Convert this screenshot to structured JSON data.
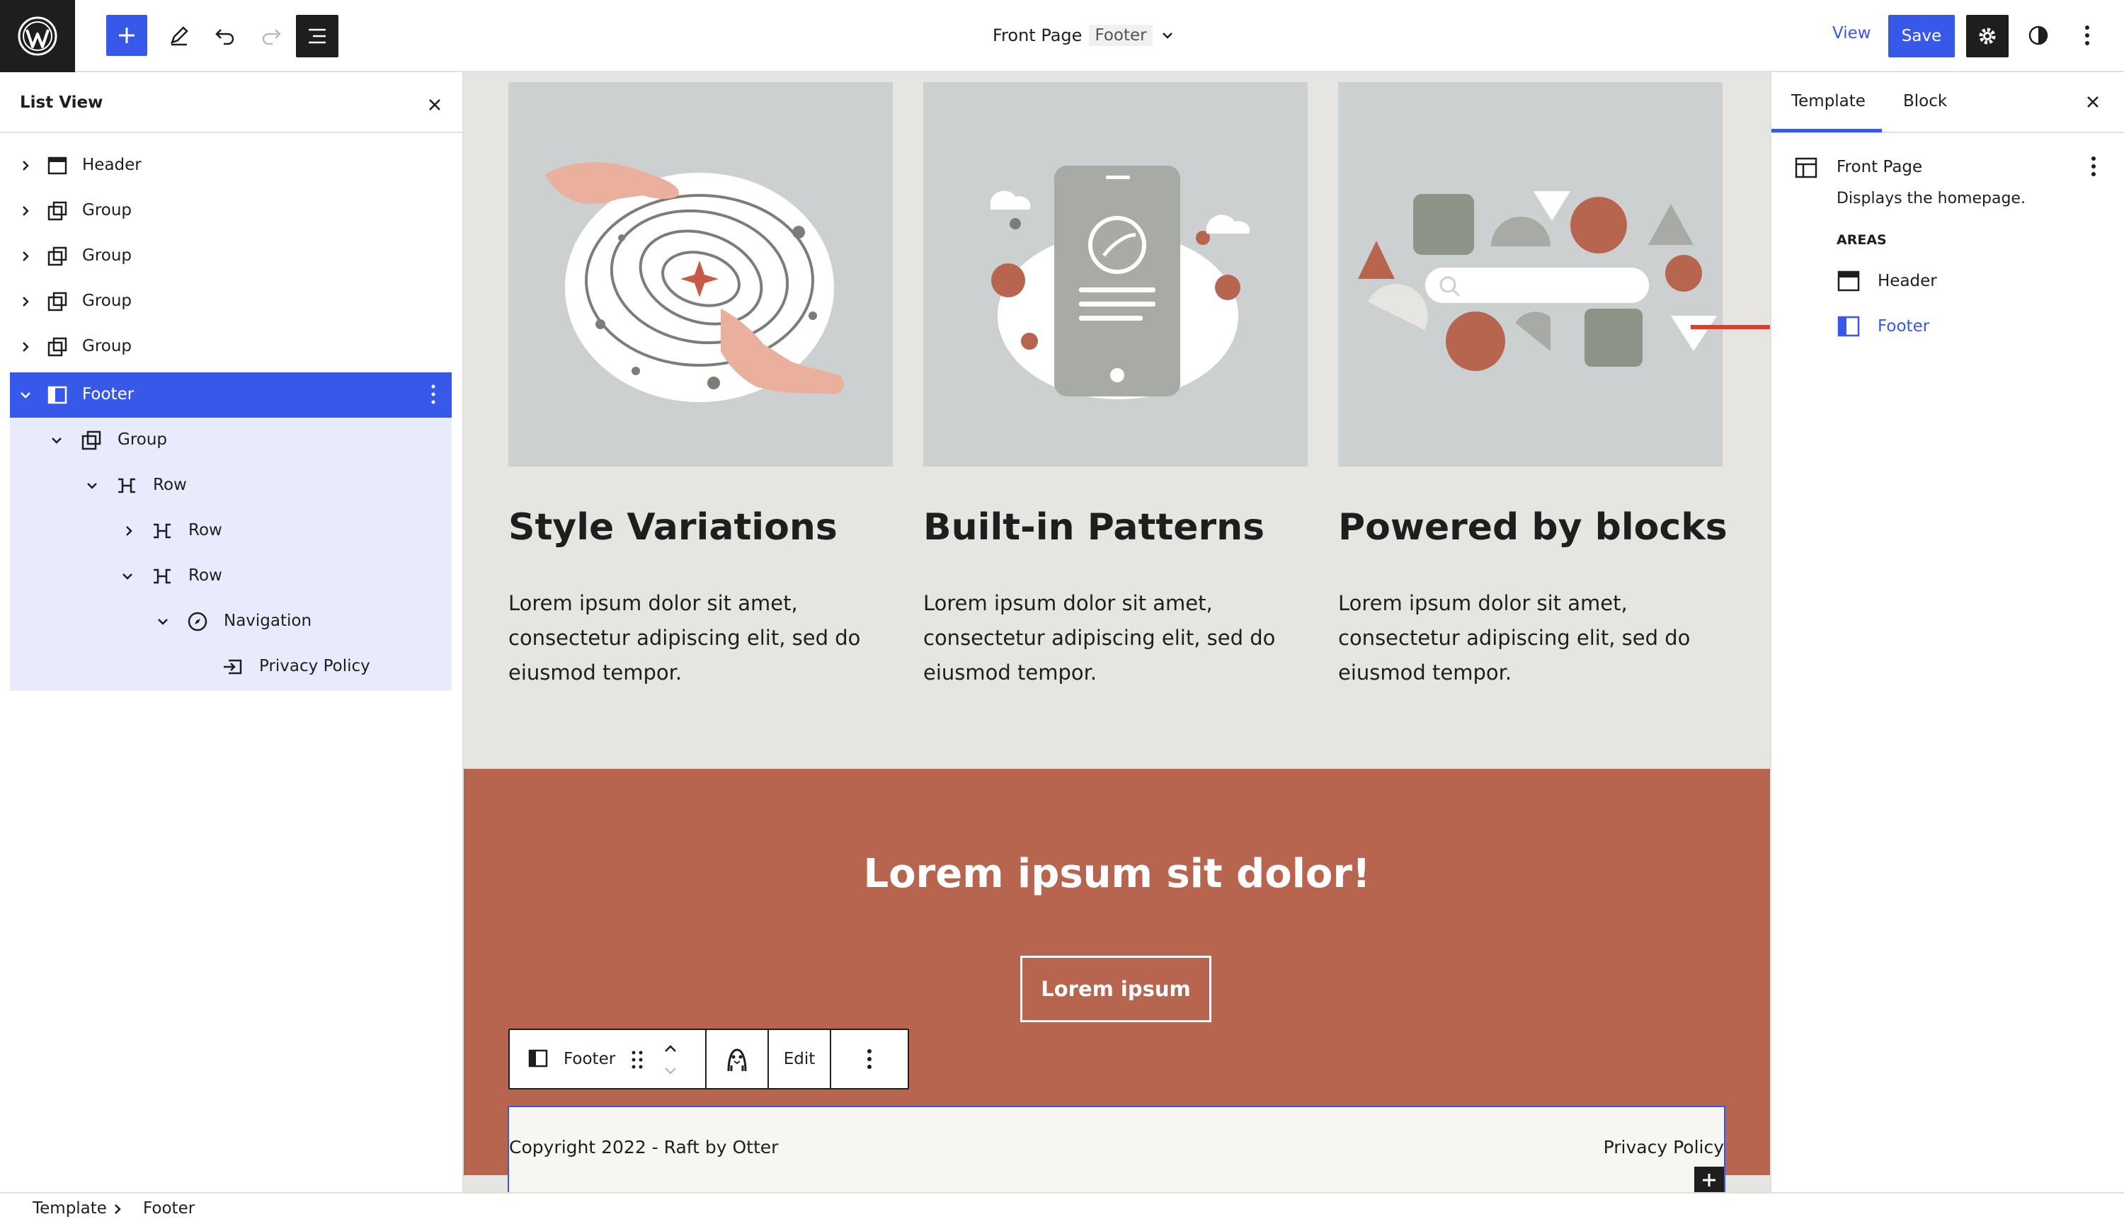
{
  "topbar": {
    "document_title": "Front Page",
    "document_tag": "Footer",
    "view_label": "View",
    "save_label": "Save"
  },
  "list_view": {
    "title": "List View",
    "items": [
      {
        "label": "Header"
      },
      {
        "label": "Group"
      },
      {
        "label": "Group"
      },
      {
        "label": "Group"
      },
      {
        "label": "Group"
      },
      {
        "label": "Footer"
      },
      {
        "label": "Group"
      },
      {
        "label": "Row"
      },
      {
        "label": "Row"
      },
      {
        "label": "Row"
      },
      {
        "label": "Navigation"
      },
      {
        "label": "Privacy Policy"
      }
    ]
  },
  "canvas": {
    "cards": [
      {
        "title": "Style Variations",
        "text": "Lorem ipsum dolor sit amet, consectetur adipiscing elit, sed do eiusmod tempor."
      },
      {
        "title": "Built-in Patterns",
        "text": "Lorem ipsum dolor sit amet, consectetur adipiscing elit, sed do eiusmod tempor."
      },
      {
        "title": "Powered by blocks",
        "text": "Lorem ipsum dolor sit amet, consectetur adipiscing elit, sed do eiusmod tempor."
      }
    ],
    "cta_title": "Lorem ipsum sit dolor!",
    "cta_button": "Lorem ipsum",
    "block_toolbar": {
      "block_label": "Footer",
      "edit_label": "Edit"
    },
    "footer": {
      "copyright": "Copyright 2022 - Raft by Otter",
      "privacy": "Privacy Policy"
    }
  },
  "sidebar": {
    "tabs": [
      "Template",
      "Block"
    ],
    "template_name": "Front Page",
    "template_desc": "Displays the homepage.",
    "areas_label": "AREAS",
    "areas": [
      {
        "label": "Header"
      },
      {
        "label": "Footer"
      }
    ]
  },
  "breadcrumb": [
    "Template",
    "Footer"
  ],
  "colors": {
    "accent": "#3858e9",
    "cta_bg": "#b86550",
    "canvas_bg": "#e6e5e2",
    "arrow": "#e23c2b"
  }
}
